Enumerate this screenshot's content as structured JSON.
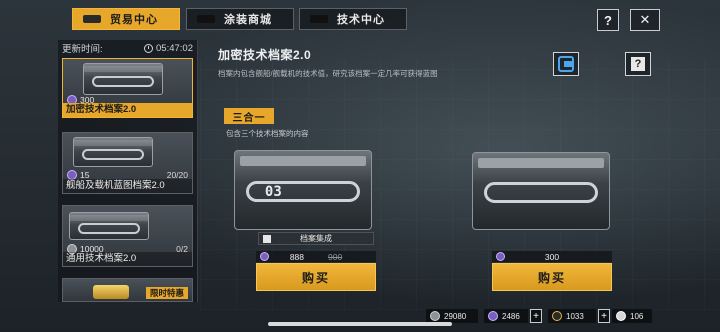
{
  "tabs": [
    {
      "label": "贸易中心",
      "active": true
    },
    {
      "label": "涂装商城",
      "active": false
    },
    {
      "label": "技术中心",
      "active": false
    }
  ],
  "top_buttons": {
    "help": "?",
    "close": "✕"
  },
  "sidebar": {
    "refresh_label": "更新时间:",
    "timer": "05:47:02",
    "items": [
      {
        "name": "加密技术档案2.0",
        "price": "300",
        "currency_icon": "purple-coin-icon",
        "count": "",
        "selected": true
      },
      {
        "name": "舰船及载机蓝图档案2.0",
        "price": "15",
        "currency_icon": "purple-coin-icon",
        "count": "20/20",
        "selected": false
      },
      {
        "name": "通用技术档案2.0",
        "price": "10000",
        "currency_icon": "gray-coin-icon",
        "count": "0/2",
        "selected": false
      },
      {
        "name": "",
        "price": "",
        "tag": "限时特惠",
        "selected": false
      }
    ]
  },
  "main": {
    "title": "加密技术档案2.0",
    "description": "档案内包含舰船/舰载机的技术值，研究该档案一定几率可获得蓝图",
    "help_label": "?",
    "bundle_badge": "三合一",
    "bundle_desc": "包含三个技术档案的内容",
    "products": [
      {
        "stamp": "03",
        "ribbon": "档案集成",
        "price": "888",
        "old_price": "900",
        "buy_label": "购买"
      },
      {
        "stamp": "",
        "ribbon": "",
        "price": "300",
        "old_price": "",
        "buy_label": "购买"
      }
    ]
  },
  "currencies": [
    {
      "icon": "gray-coin-icon",
      "value": "29080"
    },
    {
      "icon": "purple-coin-icon",
      "value": "2486",
      "plus": "+"
    },
    {
      "icon": "gold-coin-icon",
      "value": "1033",
      "plus": "+"
    },
    {
      "icon": "white-coin-icon",
      "value": "106"
    }
  ],
  "colors": {
    "accent": "#e7a72a",
    "panel": "#2b3035",
    "blue_logo": "#4aa6f0"
  }
}
